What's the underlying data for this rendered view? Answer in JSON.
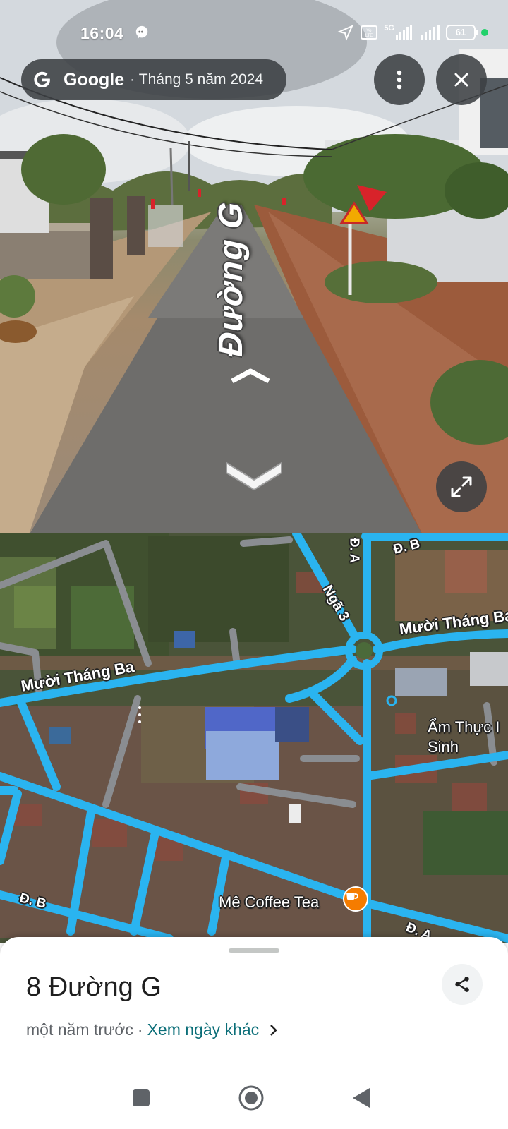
{
  "status_bar": {
    "time": "16:04",
    "network": "5G",
    "battery": "61"
  },
  "streetview": {
    "brand": "Google",
    "date": "Tháng 5 năm 2024",
    "road_label": "Đường G"
  },
  "map": {
    "labels": {
      "muoi_thang_ba_left": "Mười Tháng Ba",
      "muoi_thang_ba_right": "Mười Tháng Ba",
      "nga_3": "Ngã 3",
      "d_a_top": "Đ. A",
      "d_b_top": "Đ. B",
      "d_b_bottom": "Đ. B",
      "d_a_bottom": "Đ. A",
      "am_thuc": "Ẩm Thực I\nSinh"
    },
    "poi": {
      "name": "Mê Coffee Tea",
      "icon": "coffee-icon",
      "color": "#f57c00"
    },
    "road_color": "#2ab4f0"
  },
  "sheet": {
    "title": "8 Đường G",
    "time_ago": "một năm trước",
    "separator": "·",
    "other_dates_link": "Xem ngày khác"
  },
  "colors": {
    "link": "#0b6e78",
    "overlay": "#3c4043"
  }
}
